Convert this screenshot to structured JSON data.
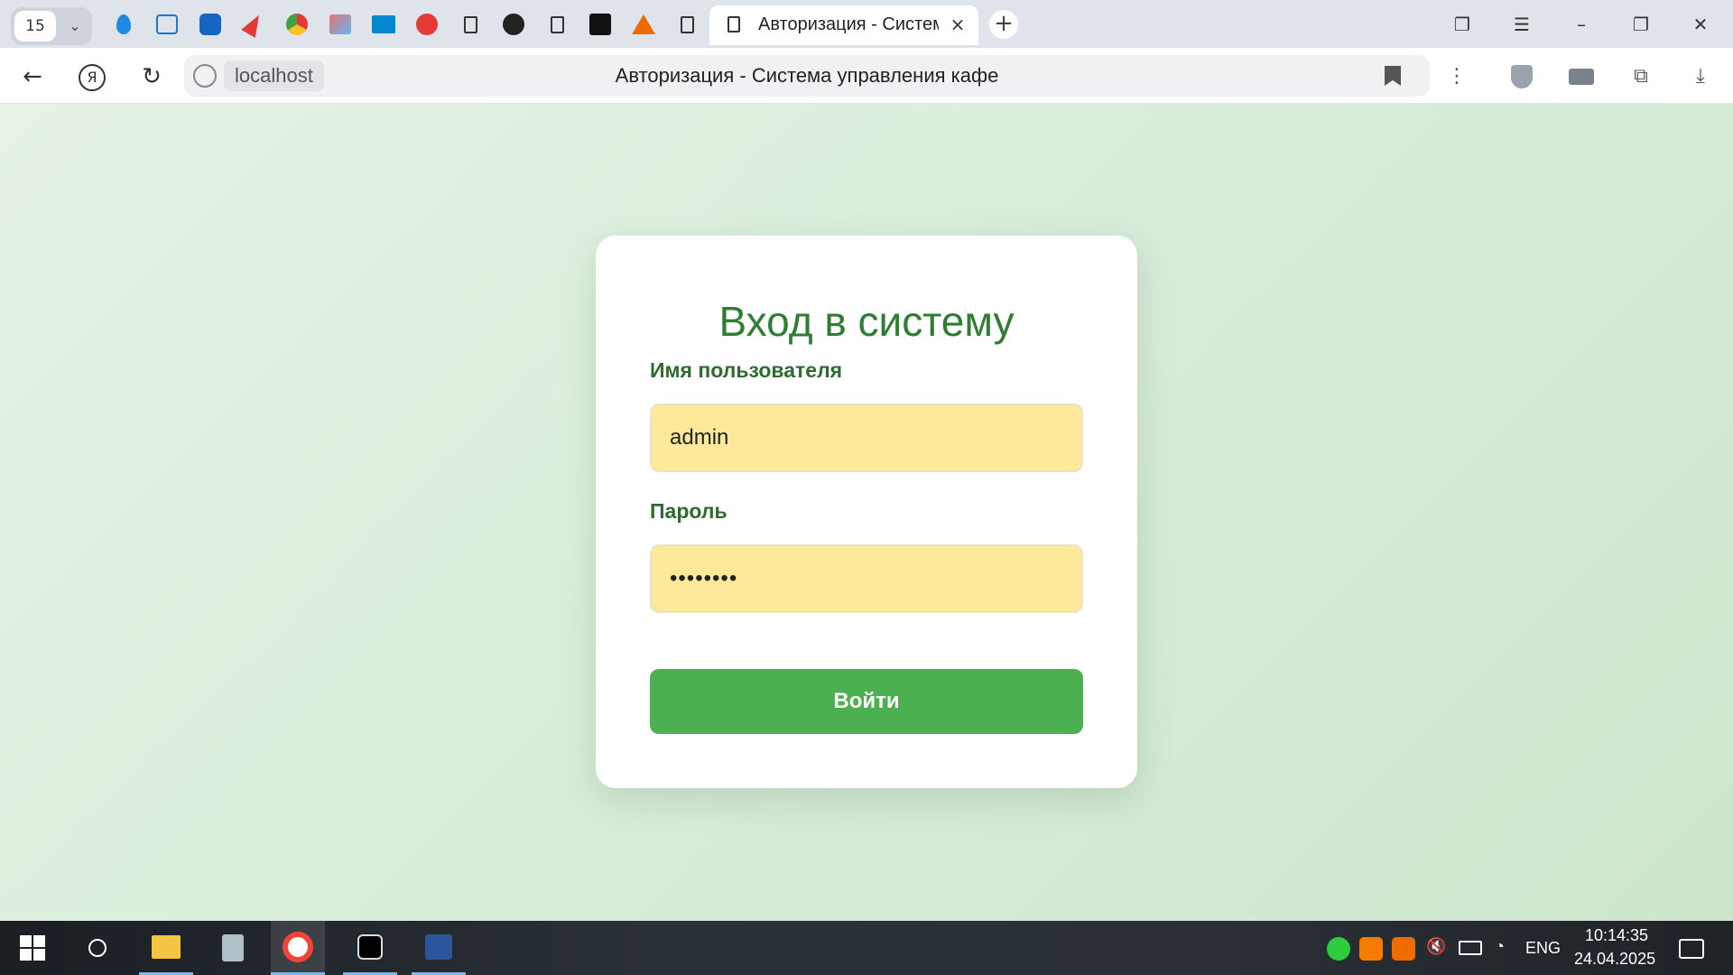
{
  "browser": {
    "tab_count": "15",
    "active_tab_title": "Авторизация - Систем",
    "address_host": "localhost",
    "page_title": "Авторизация - Система управления кафе",
    "pinned_tabs": [
      "drop-icon",
      "fond-icon",
      "mail-icon",
      "navigator-icon",
      "chrome-like-icon",
      "picture-icon",
      "monitor-icon",
      "yandex-red-icon",
      "document-icon",
      "github-icon",
      "document-icon",
      "puzzle-icon",
      "rma-icon",
      "document-icon"
    ]
  },
  "login": {
    "heading": "Вход в систему",
    "username_label": "Имя пользователя",
    "username_value": "admin",
    "password_label": "Пароль",
    "password_value": "••••••••",
    "submit_label": "Войти"
  },
  "taskbar": {
    "language": "ENG",
    "time": "10:14:35",
    "date": "24.04.2025"
  },
  "colors": {
    "accent_green": "#4caf50",
    "heading_green": "#2e7d32",
    "input_fill": "#fde99a"
  }
}
